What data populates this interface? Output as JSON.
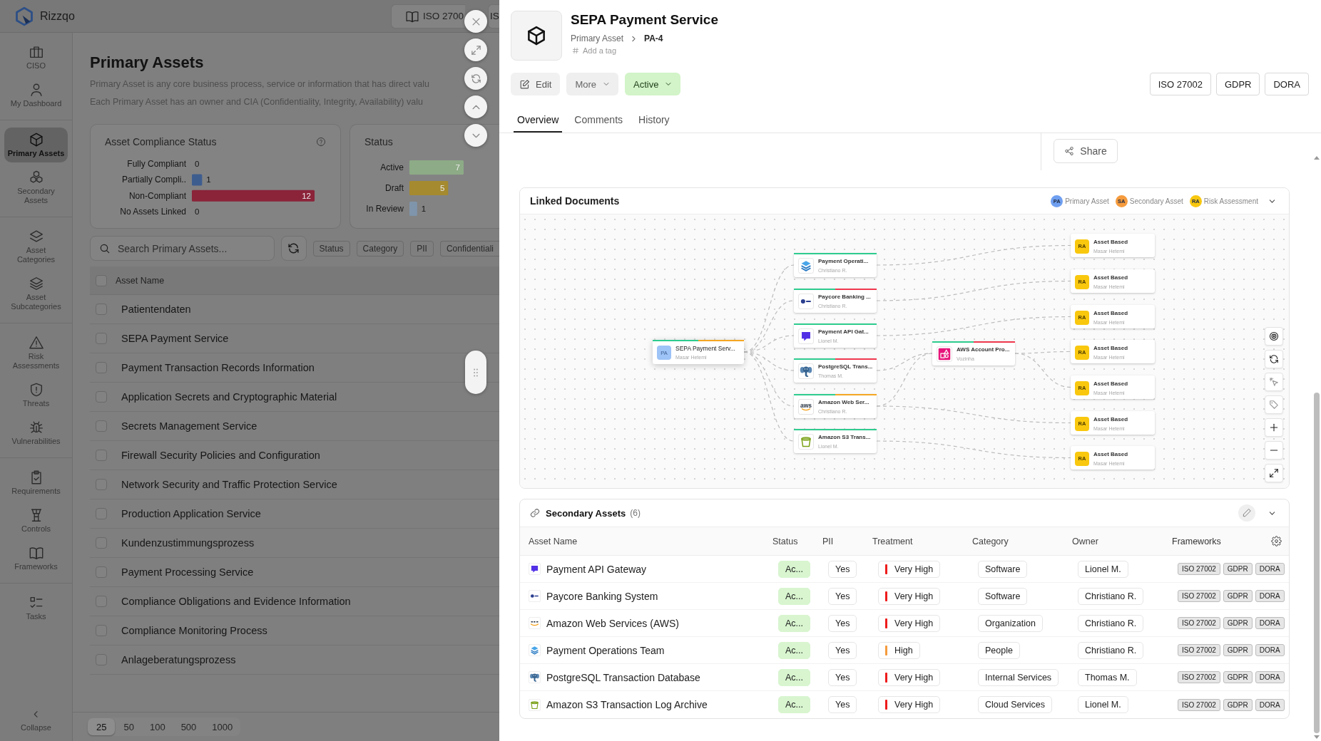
{
  "app": {
    "name": "Rizzqo"
  },
  "top_tabs": [
    {
      "label": "ISO 2700"
    },
    {
      "label": "IS"
    }
  ],
  "sidebar": {
    "groups": [
      {
        "items": [
          {
            "label": "CISO",
            "selected": false
          },
          {
            "label": "My Dashboard",
            "selected": false
          }
        ]
      },
      {
        "items": [
          {
            "label": "Primary Assets",
            "selected": true
          },
          {
            "label": "Secondary Assets",
            "selected": false
          }
        ]
      },
      {
        "items": [
          {
            "label": "Asset Categories",
            "selected": false
          },
          {
            "label": "Asset Subcategories",
            "selected": false
          }
        ]
      },
      {
        "items": [
          {
            "label": "Risk Assessments",
            "selected": false
          },
          {
            "label": "Threats",
            "selected": false
          },
          {
            "label": "Vulnerabilities",
            "selected": false
          }
        ]
      },
      {
        "items": [
          {
            "label": "Requirements",
            "selected": false
          },
          {
            "label": "Controls",
            "selected": false
          },
          {
            "label": "Frameworks",
            "selected": false
          }
        ]
      },
      {
        "items": [
          {
            "label": "Tasks",
            "selected": false
          }
        ]
      }
    ],
    "collapse": "Collapse"
  },
  "page": {
    "title": "Primary Assets",
    "description": [
      "Primary Asset is any core business process, service or information that has direct valu",
      "Each Primary Asset has an owner and CIA (Confidentiality, Integrity, Availability) valu"
    ],
    "compliance": {
      "title": "Asset Compliance Status",
      "chart_data": {
        "type": "bar",
        "orientation": "horizontal",
        "categories": [
          "Fully Compliant",
          "Partially Compli..",
          "Non-Compliant",
          "No Assets Linked"
        ],
        "values": [
          0,
          1,
          12,
          0
        ],
        "colors": [
          "#4f8a5b",
          "#3e5d8f",
          "#8b2339",
          "#6d6d6d"
        ],
        "data_labels": true
      }
    },
    "status": {
      "title": "Status",
      "chart_data": {
        "type": "bar",
        "orientation": "horizontal",
        "categories": [
          "Active",
          "Draft",
          "In Review"
        ],
        "values": [
          7,
          5,
          1
        ],
        "colors": [
          "#8dab86",
          "#a58a2f",
          "#7f95ab"
        ],
        "data_labels": true
      }
    },
    "search": {
      "placeholder": "Search Primary Assets..."
    },
    "filters": [
      "Status",
      "Category",
      "PII",
      "Confidentiali"
    ],
    "table": {
      "columns": [
        "Asset Name"
      ],
      "all_checked": false,
      "rows": [
        {
          "name": "Patientendaten",
          "checked": false
        },
        {
          "name": "SEPA Payment Service",
          "checked": false
        },
        {
          "name": "Payment Transaction Records Information",
          "checked": false
        },
        {
          "name": "Application Secrets and Cryptographic Material",
          "checked": false
        },
        {
          "name": "Secrets Management Service",
          "checked": false
        },
        {
          "name": "Firewall Security Policies and Configuration",
          "checked": false
        },
        {
          "name": "Network Security and Traffic Protection Service",
          "checked": false
        },
        {
          "name": "Production Application Service",
          "checked": false
        },
        {
          "name": "Kundenzustimmungsprozess",
          "checked": false
        },
        {
          "name": "Payment Processing Service",
          "checked": false
        },
        {
          "name": "Compliance Obligations and Evidence Information",
          "checked": false
        },
        {
          "name": "Compliance Monitoring Process",
          "checked": false
        },
        {
          "name": "Anlageberatungsprozess",
          "checked": false
        }
      ]
    },
    "page_sizes": [
      {
        "label": "25",
        "selected": true
      },
      {
        "label": "50",
        "selected": false
      },
      {
        "label": "100",
        "selected": false
      },
      {
        "label": "500",
        "selected": false
      },
      {
        "label": "1000",
        "selected": false
      }
    ]
  },
  "drawer": {
    "title": "SEPA Payment Service",
    "breadcrumb": [
      "Primary Asset",
      "PA-4"
    ],
    "tag_action": "Add a tag",
    "actions": {
      "edit": "Edit",
      "more": "More",
      "status": "Active"
    },
    "frameworks": [
      "ISO 27002",
      "GDPR",
      "DORA"
    ],
    "tabs": [
      {
        "label": "Overview",
        "selected": true
      },
      {
        "label": "Comments",
        "selected": false
      },
      {
        "label": "History",
        "selected": false
      }
    ],
    "share": "Share",
    "linked_documents": {
      "title": "Linked Documents",
      "legend": [
        {
          "badge": "PA",
          "label": "Primary Asset",
          "color": "#6f9ff0"
        },
        {
          "badge": "SA",
          "label": "Secondary Asset",
          "color": "#f59b3d"
        },
        {
          "badge": "RA",
          "label": "Risk Assessment",
          "color": "#f8c70f"
        }
      ],
      "graph": {
        "nodes": [
          {
            "kind": "primary",
            "badge": "PA",
            "title": "SEPA Payment Serv...",
            "subtitle": "Masar Hetemi",
            "accents": [
              {
                "color": "#2ecc8f"
              },
              {
                "color": "#f5a623"
              }
            ]
          },
          {
            "kind": "secondary",
            "title": "Payment Operati...",
            "subtitle": "Christiano R.",
            "accents": [
              {
                "color": "#2ecc8f"
              }
            ]
          },
          {
            "kind": "secondary",
            "title": "Paycore Banking ...",
            "subtitle": "Christiano R.",
            "accents": [
              {
                "color": "#2ecc8f"
              },
              {
                "color": "#f0384f"
              }
            ]
          },
          {
            "kind": "secondary",
            "title": "Payment API Gat...",
            "subtitle": "Lionel M.",
            "accents": [
              {
                "color": "#2ecc8f"
              }
            ]
          },
          {
            "kind": "secondary",
            "title": "PostgreSQL Trans...",
            "subtitle": "Thomas M.",
            "accents": [
              {
                "color": "#2ecc8f"
              },
              {
                "color": "#f0384f"
              }
            ]
          },
          {
            "kind": "secondary",
            "logo_text": "aws",
            "title": "Amazon Web Ser...",
            "subtitle": "Christiano R.",
            "accents": [
              {
                "color": "#2ecc8f"
              },
              {
                "color": "#f5a623"
              }
            ]
          },
          {
            "kind": "secondary",
            "title": "Amazon S3 Trans...",
            "subtitle": "Lionel M.",
            "accents": [
              {
                "color": "#2ecc8f"
              }
            ]
          },
          {
            "kind": "secondary",
            "title": "AWS Account Pro...",
            "subtitle": "Vozinha",
            "accents": [
              {
                "color": "#2ecc8f"
              },
              {
                "color": "#f0384f"
              }
            ]
          },
          {
            "kind": "risk",
            "badge": "RA",
            "title": "Asset Based",
            "subtitle": "Masar Hetemi"
          },
          {
            "kind": "risk",
            "badge": "RA",
            "title": "Asset Based",
            "subtitle": "Masar Hetemi"
          },
          {
            "kind": "risk",
            "badge": "RA",
            "title": "Asset Based",
            "subtitle": "Masar Hetemi"
          },
          {
            "kind": "risk",
            "badge": "RA",
            "title": "Asset Based",
            "subtitle": "Masar Hetemi"
          },
          {
            "kind": "risk",
            "badge": "RA",
            "title": "Asset Based",
            "subtitle": "Masar Hetemi"
          },
          {
            "kind": "risk",
            "badge": "RA",
            "title": "Asset Based",
            "subtitle": "Masar Hetemi"
          },
          {
            "kind": "risk",
            "badge": "RA",
            "title": "Asset Based",
            "subtitle": "Masar Hetemi"
          }
        ]
      }
    },
    "secondary_assets": {
      "title": "Secondary Assets",
      "count": "(6)",
      "columns": [
        "Asset Name",
        "Status",
        "PII",
        "Treatment",
        "Category",
        "Owner",
        "Frameworks"
      ],
      "rows": [
        {
          "name": "Payment API Gateway",
          "status": "Ac...",
          "pii": "Yes",
          "treatment": {
            "label": "Very High",
            "color": "#ee1b1b"
          },
          "category": "Software",
          "owner": "Lionel M.",
          "frameworks": [
            "ISO 27002",
            "GDPR",
            "DORA"
          ]
        },
        {
          "name": "Paycore Banking System",
          "status": "Ac...",
          "pii": "Yes",
          "treatment": {
            "label": "Very High",
            "color": "#ee1b1b"
          },
          "category": "Software",
          "owner": "Christiano R.",
          "frameworks": [
            "ISO 27002",
            "GDPR",
            "DORA"
          ]
        },
        {
          "name": "Amazon Web Services (AWS)",
          "status": "Ac...",
          "pii": "Yes",
          "treatment": {
            "label": "Very High",
            "color": "#ee1b1b"
          },
          "category": "Organization",
          "owner": "Christiano R.",
          "frameworks": [
            "ISO 27002",
            "GDPR",
            "DORA"
          ]
        },
        {
          "name": "Payment Operations Team",
          "status": "Ac...",
          "pii": "Yes",
          "treatment": {
            "label": "High",
            "color": "#f59b3d"
          },
          "category": "People",
          "owner": "Christiano R.",
          "frameworks": [
            "ISO 27002",
            "GDPR",
            "DORA"
          ]
        },
        {
          "name": "PostgreSQL Transaction Database",
          "status": "Ac...",
          "pii": "Yes",
          "treatment": {
            "label": "Very High",
            "color": "#ee1b1b"
          },
          "category": "Internal Services",
          "owner": "Thomas M.",
          "frameworks": [
            "ISO 27002",
            "GDPR",
            "DORA"
          ]
        },
        {
          "name": "Amazon S3 Transaction Log Archive",
          "status": "Ac...",
          "pii": "Yes",
          "treatment": {
            "label": "Very High",
            "color": "#ee1b1b"
          },
          "category": "Cloud Services",
          "owner": "Lionel M.",
          "frameworks": [
            "ISO 27002",
            "GDPR",
            "DORA"
          ]
        }
      ]
    }
  }
}
